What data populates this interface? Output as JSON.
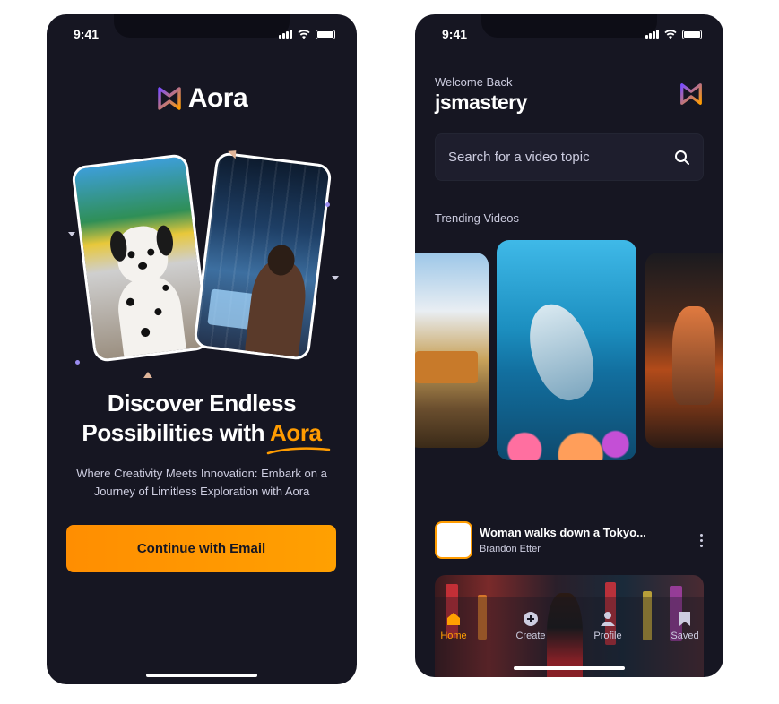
{
  "status_bar": {
    "time": "9:41"
  },
  "onboarding": {
    "brand": "Aora",
    "headline_line1": "Discover Endless",
    "headline_line2_prefix": "Possibilities with ",
    "headline_brand": "Aora",
    "subtitle": "Where Creativity Meets Innovation: Embark on a Journey of Limitless Exploration with Aora",
    "cta_label": "Continue with Email"
  },
  "home": {
    "welcome": "Welcome Back",
    "username": "jsmastery",
    "search": {
      "placeholder": "Search for a video topic"
    },
    "trending_title": "Trending Videos",
    "video": {
      "title": "Woman walks down a Tokyo...",
      "author": "Brandon Etter"
    },
    "tabs": [
      {
        "label": "Home",
        "icon": "home-icon",
        "active": true
      },
      {
        "label": "Create",
        "icon": "plus-icon",
        "active": false
      },
      {
        "label": "Profile",
        "icon": "profile-icon",
        "active": false
      },
      {
        "label": "Saved",
        "icon": "bookmark-icon",
        "active": false
      }
    ]
  },
  "colors": {
    "background": "#161622",
    "accent": "#ff9c01",
    "text_muted": "#cdcde0",
    "logo_purple": "#7b4dff",
    "logo_orange": "#ff9c01"
  }
}
